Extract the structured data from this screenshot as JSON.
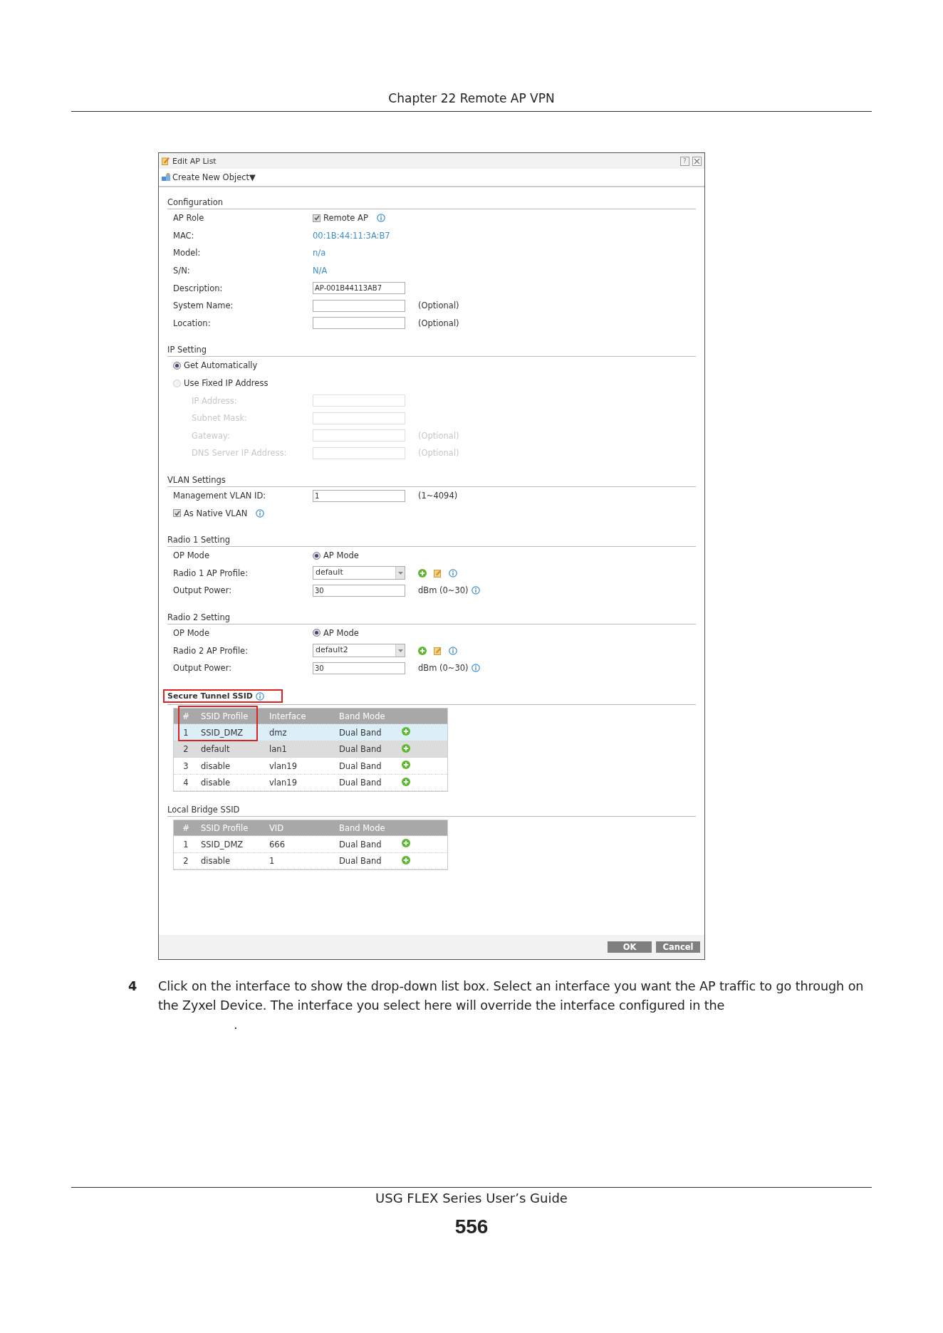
{
  "page_header": "Chapter 22 Remote AP VPN",
  "dialog": {
    "title": "Edit AP List",
    "help": "?",
    "toolbar": {
      "label": "Create New Object",
      "caret": "▼"
    },
    "sections": [
      {
        "title": "Configuration",
        "rows": [
          {
            "kind": "checkbox",
            "label": "AP Role",
            "option": "Remote AP",
            "checked": true,
            "info": true
          },
          {
            "kind": "value",
            "label": "MAC:",
            "value": "00:1B:44:11:3A:B7"
          },
          {
            "kind": "value",
            "label": "Model:",
            "value": "n/a"
          },
          {
            "kind": "value",
            "label": "S/N:",
            "value": "N/A"
          },
          {
            "kind": "field",
            "label": "Description:",
            "value": "AP-001B44113AB7"
          },
          {
            "kind": "field",
            "label": "System Name:",
            "note": "(Optional)"
          },
          {
            "kind": "field",
            "label": "Location:",
            "note": "(Optional)"
          }
        ]
      },
      {
        "title": "IP Setting",
        "rows": [
          {
            "kind": "radio",
            "option": "Get Automatically",
            "selected": true
          },
          {
            "kind": "radio",
            "option": "Use Fixed IP Address",
            "selected": false
          },
          {
            "kind": "field",
            "label": "IP Address:",
            "disabled": true
          },
          {
            "kind": "field",
            "label": "Subnet Mask:",
            "disabled": true
          },
          {
            "kind": "field",
            "label": "Gateway:",
            "note": "(Optional)",
            "disabled": true
          },
          {
            "kind": "field",
            "label": "DNS Server IP Address:",
            "note": "(Optional)",
            "disabled": true
          }
        ]
      },
      {
        "title": "VLAN Settings",
        "rows": [
          {
            "kind": "field",
            "label": "Management VLAN ID:",
            "value": "1",
            "note": "(1~4094)"
          },
          {
            "kind": "checkbox",
            "option": "As Native VLAN",
            "checked": true,
            "info": true
          }
        ]
      },
      {
        "title": "Radio 1 Setting",
        "rows": [
          {
            "kind": "radio",
            "label": "OP Mode",
            "option": "AP Mode",
            "selected": true
          },
          {
            "kind": "select",
            "label": "Radio 1 AP Profile:",
            "value": "default"
          },
          {
            "kind": "field",
            "label": "Output Power:",
            "value": "30",
            "note": "dBm (0~30)",
            "info": true
          }
        ]
      },
      {
        "title": "Radio 2 Setting",
        "rows": [
          {
            "kind": "radio",
            "label": "OP Mode",
            "option": "AP Mode",
            "selected": true
          },
          {
            "kind": "select",
            "label": "Radio 2 AP Profile:",
            "value": "default2"
          },
          {
            "kind": "field",
            "label": "Output Power:",
            "value": "30",
            "note": "dBm (0~30)",
            "info": true
          }
        ]
      },
      {
        "title": "Secure Tunnel SSID",
        "highlighted": true,
        "info": true,
        "table": {
          "callout": true,
          "columns": [
            "#",
            "SSID Profile",
            "Interface",
            "Band Mode"
          ],
          "rows": [
            {
              "cells": [
                "1",
                "SSID_DMZ",
                "dmz",
                "Dual Band"
              ],
              "selected": true,
              "hovered": false
            },
            {
              "cells": [
                "2",
                "default",
                "lan1",
                "Dual Band"
              ],
              "selected": false,
              "hovered": true
            },
            {
              "cells": [
                "3",
                "disable",
                "vlan19",
                "Dual Band"
              ],
              "selected": false,
              "hovered": false
            },
            {
              "cells": [
                "4",
                "disable",
                "vlan19",
                "Dual Band"
              ],
              "selected": false,
              "hovered": false
            }
          ]
        }
      },
      {
        "title": "Local Bridge SSID",
        "table": {
          "columns": [
            "#",
            "SSID Profile",
            "VID",
            "Band Mode"
          ],
          "rows": [
            {
              "cells": [
                "1",
                "SSID_DMZ",
                "666",
                "Dual Band"
              ],
              "selected": false,
              "hovered": false
            },
            {
              "cells": [
                "2",
                "disable",
                "1",
                "Dual Band"
              ],
              "selected": false,
              "hovered": false
            }
          ]
        }
      }
    ],
    "buttons": [
      "OK",
      "Cancel"
    ]
  },
  "step": {
    "number": "4",
    "text": "Click on the interface to show the drop-down list box. Select an interface you want the AP traffic to go through on the Zyxel Device. The interface you select here will override the interface configured in the",
    "trailing": "."
  },
  "footer": {
    "title": "USG FLEX Series User’s Guide",
    "page": "556"
  }
}
